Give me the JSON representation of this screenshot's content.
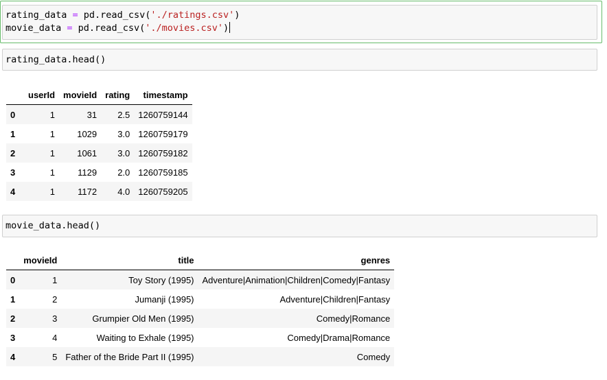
{
  "cells": [
    {
      "id": "cell-1",
      "lines": [
        {
          "var": "rating_data",
          "op": " = ",
          "call": "pd.read_csv(",
          "str": "'./ratings.csv'",
          "close": ")"
        },
        {
          "var": "movie_data",
          "op": " = ",
          "call": "pd.read_csv(",
          "str": "'./movies.csv'",
          "close": ")"
        }
      ]
    },
    {
      "id": "cell-2",
      "code": "rating_data.head()"
    },
    {
      "id": "cell-3",
      "code": "movie_data.head()"
    }
  ],
  "ratings_table": {
    "columns": [
      "",
      "userId",
      "movieId",
      "rating",
      "timestamp"
    ],
    "rows": [
      [
        "0",
        "1",
        "31",
        "2.5",
        "1260759144"
      ],
      [
        "1",
        "1",
        "1029",
        "3.0",
        "1260759179"
      ],
      [
        "2",
        "1",
        "1061",
        "3.0",
        "1260759182"
      ],
      [
        "3",
        "1",
        "1129",
        "2.0",
        "1260759185"
      ],
      [
        "4",
        "1",
        "1172",
        "4.0",
        "1260759205"
      ]
    ]
  },
  "movies_table": {
    "columns": [
      "",
      "movieId",
      "title",
      "genres"
    ],
    "rows": [
      [
        "0",
        "1",
        "Toy Story (1995)",
        "Adventure|Animation|Children|Comedy|Fantasy"
      ],
      [
        "1",
        "2",
        "Jumanji (1995)",
        "Adventure|Children|Fantasy"
      ],
      [
        "2",
        "3",
        "Grumpier Old Men (1995)",
        "Comedy|Romance"
      ],
      [
        "3",
        "4",
        "Waiting to Exhale (1995)",
        "Comedy|Drama|Romance"
      ],
      [
        "4",
        "5",
        "Father of the Bride Part II (1995)",
        "Comedy"
      ]
    ]
  },
  "colors": {
    "selected_border": "#66bb6a",
    "code_bg": "#f7f7f7",
    "operator": "#aa22ff",
    "string": "#ba2121",
    "striped_row": "#f5f5f5"
  }
}
